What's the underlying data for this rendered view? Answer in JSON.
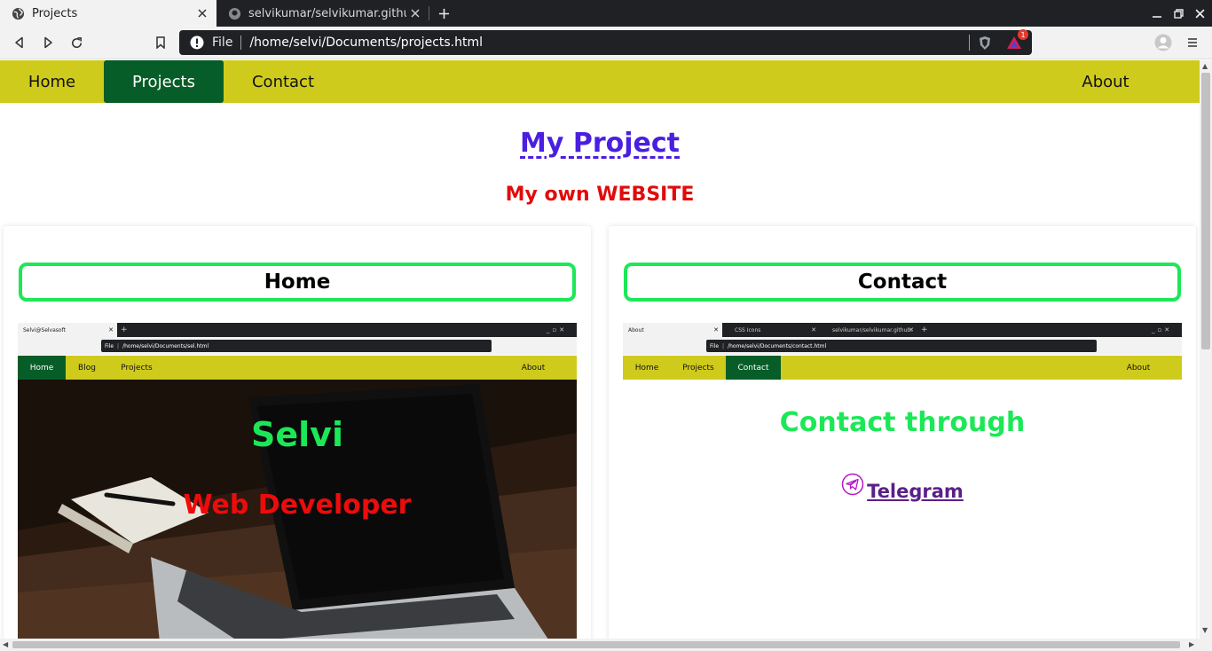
{
  "browser": {
    "tabs": [
      {
        "title": "Projects",
        "active": true,
        "icon": "globe-icon"
      },
      {
        "title": "selvikumar/selvikumar.github.",
        "active": false,
        "icon": "github-icon"
      }
    ],
    "address": {
      "scheme": "File",
      "url": "/home/selvi/Documents/projects.html"
    },
    "rewards_badge": "1"
  },
  "nav": {
    "items": [
      {
        "label": "Home"
      },
      {
        "label": "Projects",
        "active": true
      },
      {
        "label": "Contact"
      }
    ],
    "right_item": "About"
  },
  "page": {
    "title": "My Project",
    "subtitle": "My own WEBSITE"
  },
  "cards": [
    {
      "heading": "Home",
      "shot": {
        "tab_title": "Selvi@Selvasoft",
        "url": "/home/selvi/Documents/sel.html",
        "scheme": "File",
        "nav": [
          "Home",
          "Blog",
          "Projects"
        ],
        "nav_right": "About",
        "active": "Home",
        "hero_name": "Selvi",
        "hero_role": "Web Developer"
      }
    },
    {
      "heading": "Contact",
      "shot": {
        "tabs": [
          "About",
          "CSS Icons",
          "selvikumar/selvikumar.github."
        ],
        "url": "/home/selvi/Documents/contact.html",
        "scheme": "File",
        "nav": [
          "Home",
          "Projects",
          "Contact"
        ],
        "nav_right": "About",
        "active": "Contact",
        "body_title": "Contact through",
        "link": "Telegram"
      }
    }
  ],
  "colors": {
    "nav_bg": "#cfcb1d",
    "nav_active": "#075d28",
    "title_link": "#4a1fe0",
    "subtitle": "#e10b0b",
    "card_border": "#1ce857"
  }
}
